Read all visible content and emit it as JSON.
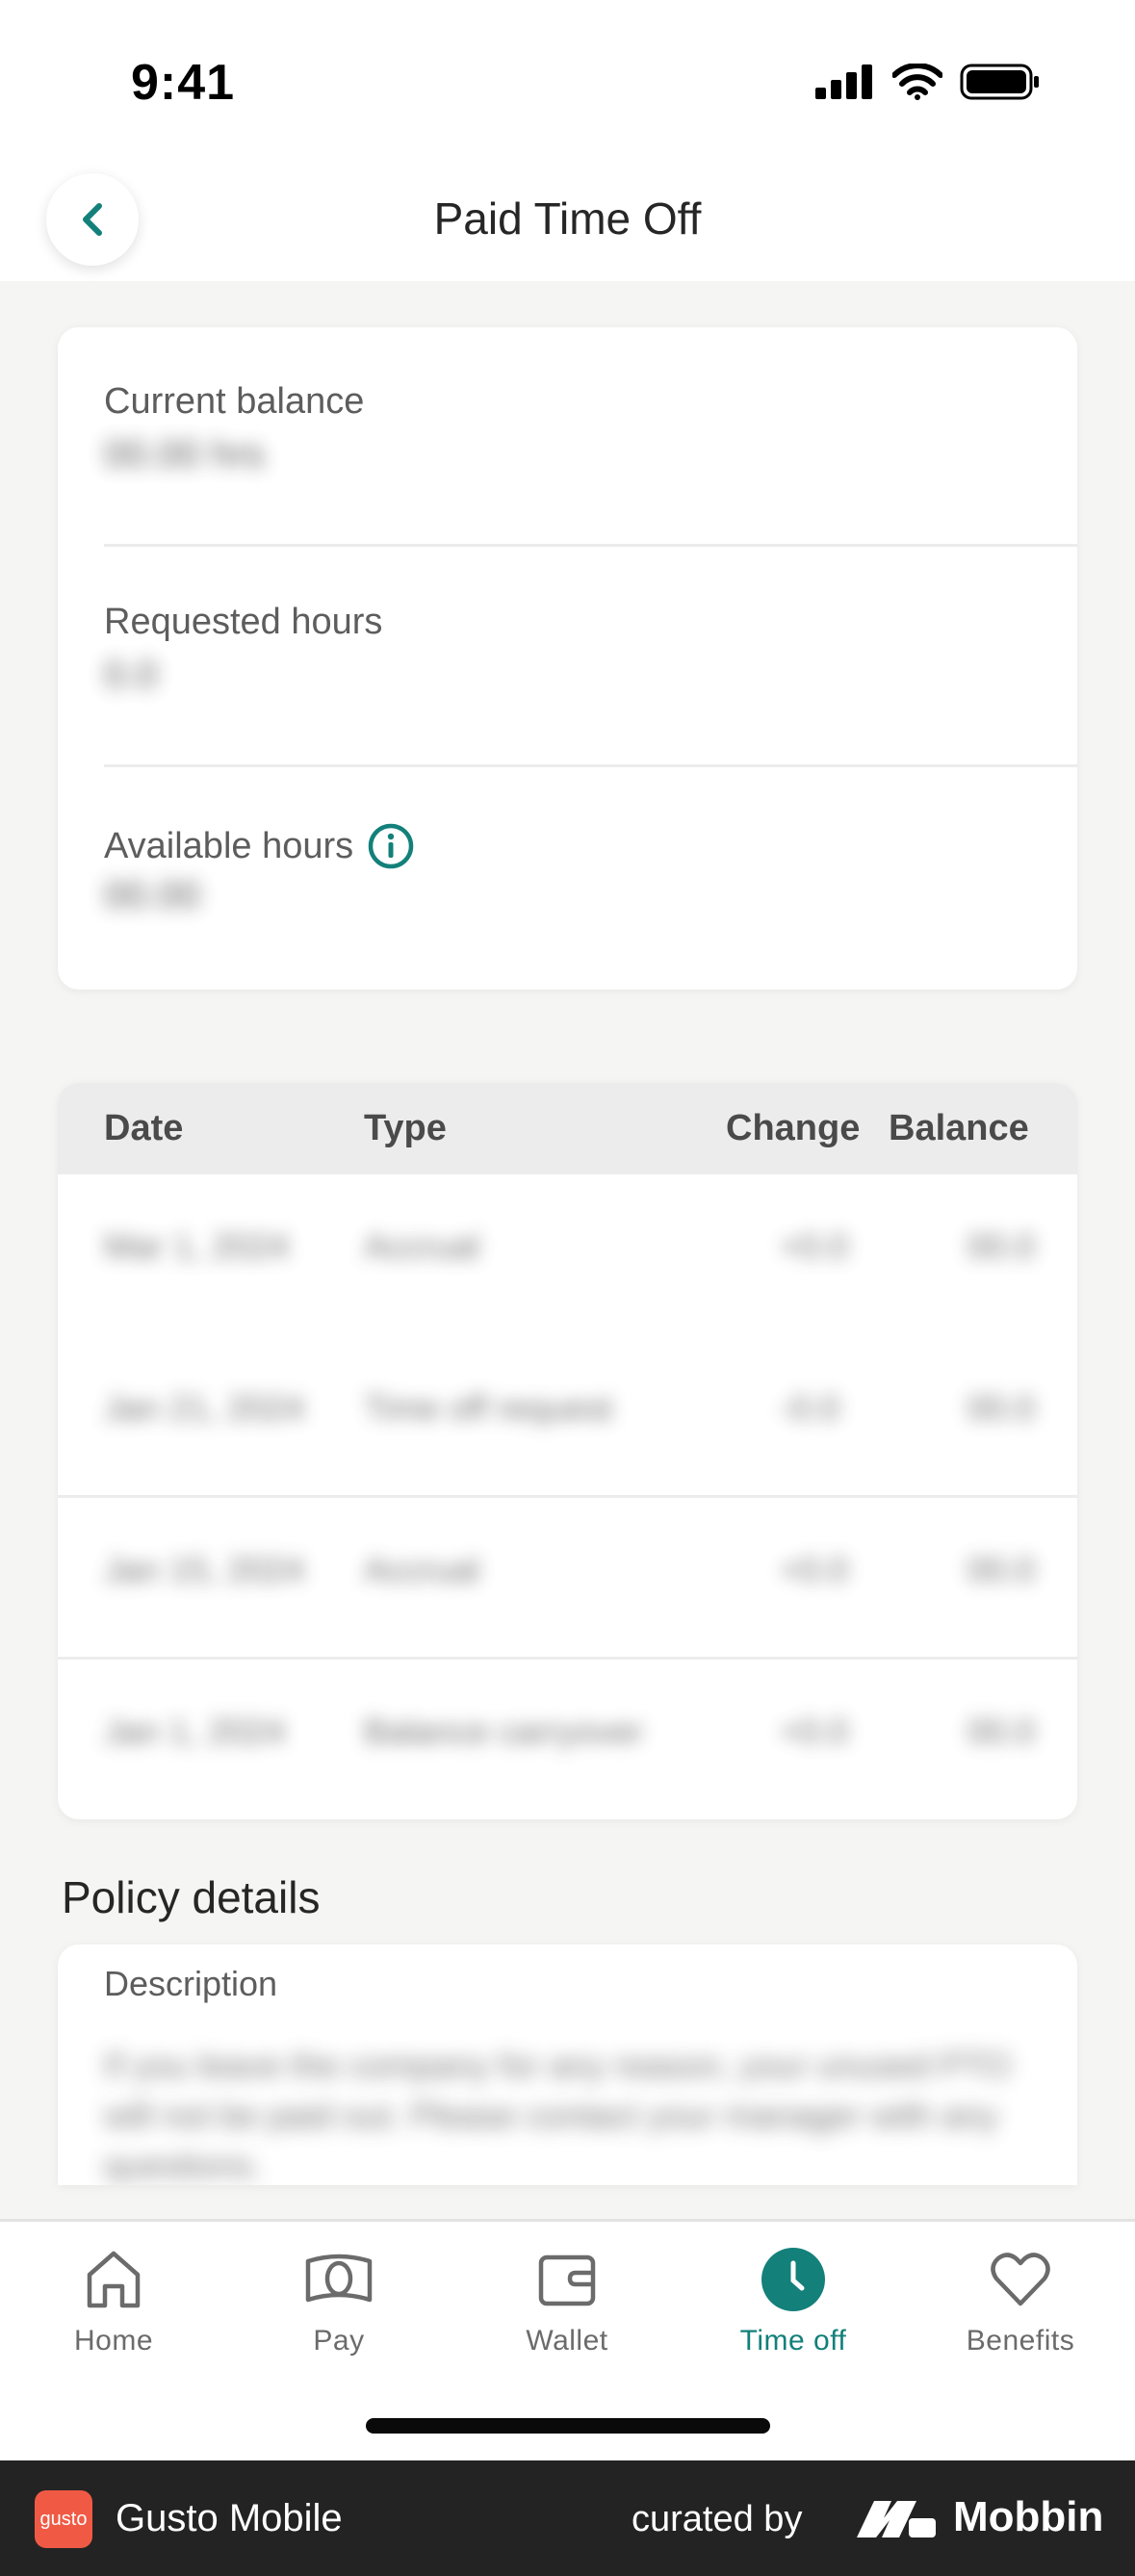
{
  "status_bar": {
    "time": "9:41"
  },
  "header": {
    "title": "Paid Time Off"
  },
  "summary": {
    "items": [
      {
        "label": "Current balance",
        "value": "00.00 hrs"
      },
      {
        "label": "Requested hours",
        "value": "0.0"
      },
      {
        "label": "Available hours",
        "value": "00.00"
      }
    ]
  },
  "history": {
    "columns": [
      "Date",
      "Type",
      "Change",
      "Balance"
    ],
    "rows": [
      {
        "date": "Mar 1, 2024",
        "type": "Accrual",
        "change": "+0.0",
        "balance": "00.0"
      },
      {
        "date": "Jan 21, 2024",
        "type": "Time off request",
        "change": "-0.0",
        "balance": "00.0"
      },
      {
        "date": "Jan 15, 2024",
        "type": "Accrual",
        "change": "+0.0",
        "balance": "00.0"
      },
      {
        "date": "Jan 1, 2024",
        "type": "Balance carryover",
        "change": "+0.0",
        "balance": "00.0"
      }
    ]
  },
  "policy": {
    "title": "Policy details",
    "description_label": "Description",
    "description_text": "If you leave the company for any reason, your unused PTO will not be paid out. Please contact your manager with any questions."
  },
  "tabs": [
    {
      "label": "Home",
      "icon": "home-icon"
    },
    {
      "label": "Pay",
      "icon": "pay-icon"
    },
    {
      "label": "Wallet",
      "icon": "wallet-icon"
    },
    {
      "label": "Time off",
      "icon": "clock-icon"
    },
    {
      "label": "Benefits",
      "icon": "heart-icon"
    }
  ],
  "footer": {
    "app_logo_text": "gusto",
    "app_name": "Gusto Mobile",
    "curated_by": "curated by",
    "brand": "Mobbin"
  },
  "colors": {
    "accent": "#13807a",
    "footer_bg": "#232323",
    "logo_bg": "#f05a45"
  }
}
